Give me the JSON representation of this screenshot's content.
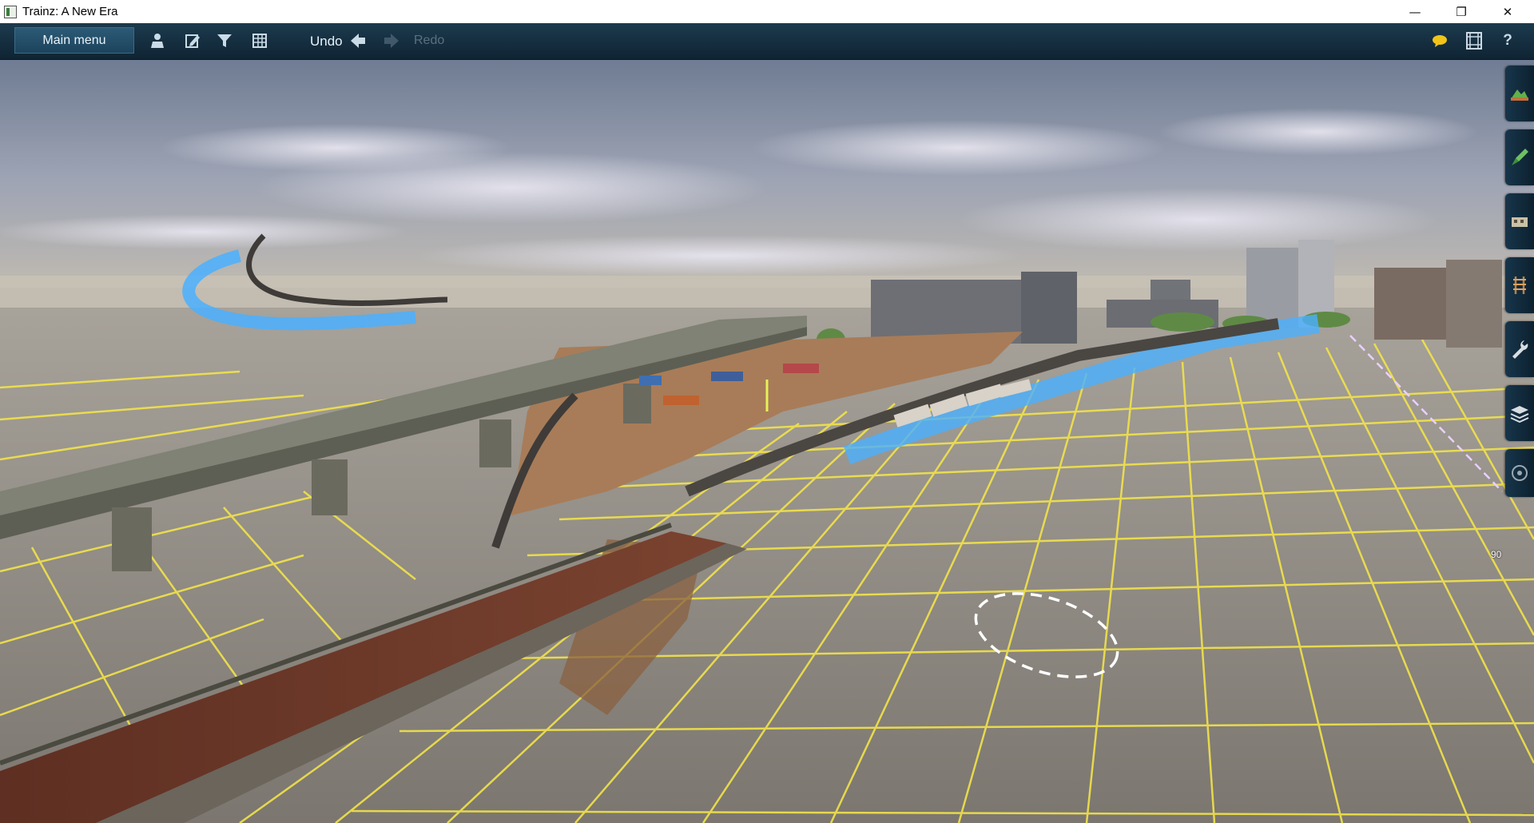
{
  "window": {
    "title": "Trainz: A New Era",
    "minimize_glyph": "—",
    "maximize_glyph": "❐",
    "close_glyph": "✕"
  },
  "toolbar": {
    "main_menu_label": "Main menu",
    "undo_label": "Undo",
    "redo_label": "Redo",
    "icons": [
      "driver-icon",
      "edit-icon",
      "filter-icon",
      "grid-icon",
      "undo-arrow-icon",
      "redo-arrow-icon",
      "chat-icon",
      "film-icon",
      "help-icon"
    ],
    "help_glyph": "?"
  },
  "side_tabs": [
    {
      "name": "terrain-tool-tab",
      "icon": "terrain-icon"
    },
    {
      "name": "paint-tool-tab",
      "icon": "brush-icon"
    },
    {
      "name": "objects-tool-tab",
      "icon": "objects-icon"
    },
    {
      "name": "track-tool-tab",
      "icon": "track-icon"
    },
    {
      "name": "tools-tab",
      "icon": "wrench-icon"
    },
    {
      "name": "layers-tab",
      "icon": "layers-icon"
    },
    {
      "name": "compass-tab",
      "icon": "compass-icon"
    }
  ],
  "viewport": {
    "compass_reading": "90"
  },
  "colors": {
    "toolbar_bg": "#123046",
    "grid_line": "#f2e34a",
    "ground": "#87817a",
    "water": "#4ab0ff",
    "track_bed": "#6e3a28",
    "sky_top": "#7d8aa0",
    "haze": "#bfb8ad"
  }
}
